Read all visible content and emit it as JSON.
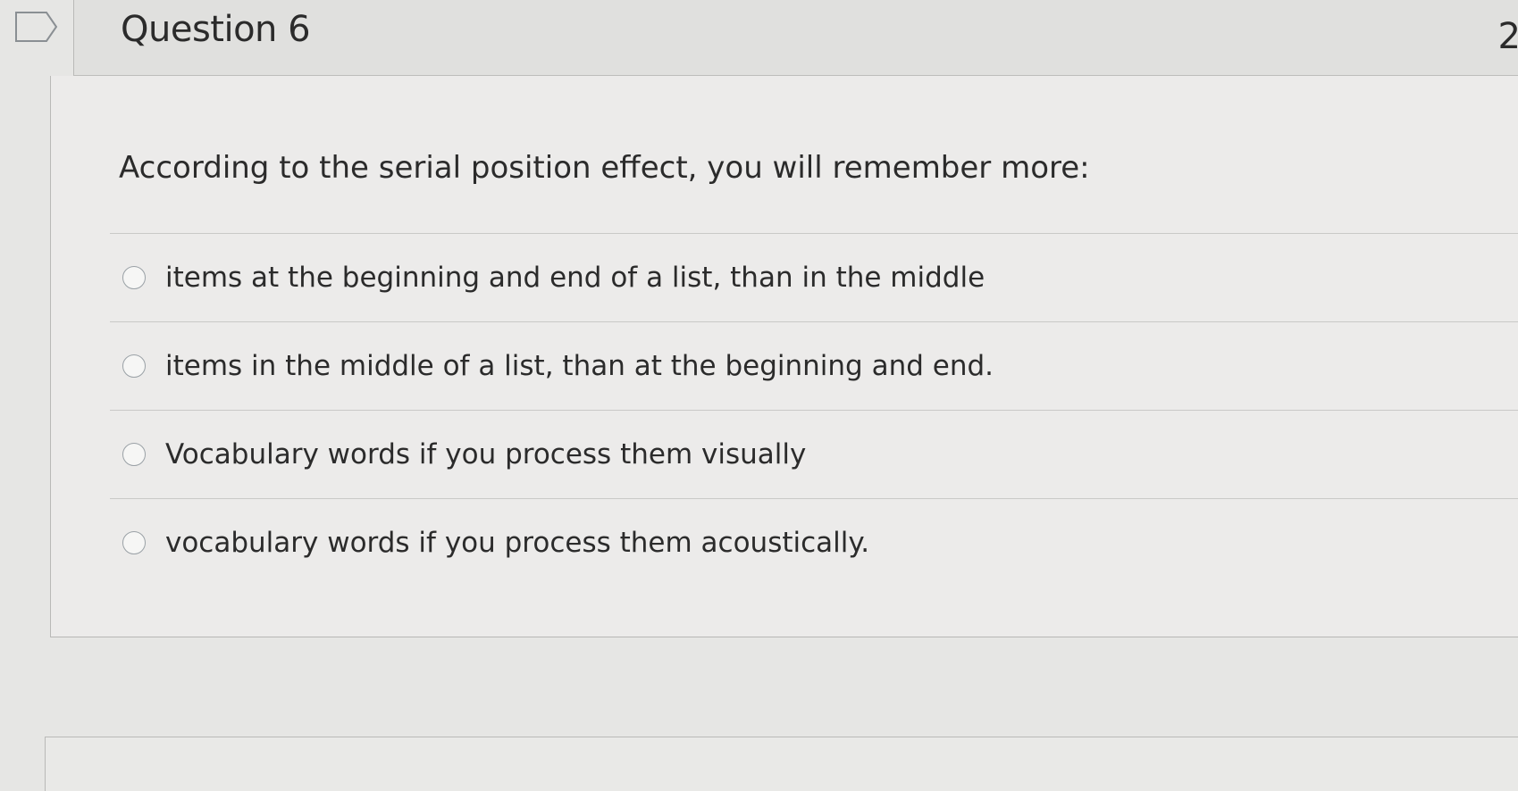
{
  "question": {
    "title": "Question 6",
    "points": "2",
    "prompt": "According to the serial position effect, you will remember more:",
    "answers": [
      "items at the beginning and end of a list, than in the middle",
      "items in the middle of a list, than at the beginning and end.",
      "Vocabulary words if you process them visually",
      "vocabulary words if you process them acoustically."
    ]
  },
  "icons": {
    "flag": "flag-icon",
    "radio": "radio-button"
  },
  "colors": {
    "background": "#e6e6e4",
    "card": "#ecebea",
    "text": "#2b2b2b",
    "border": "#c9c9c7"
  }
}
